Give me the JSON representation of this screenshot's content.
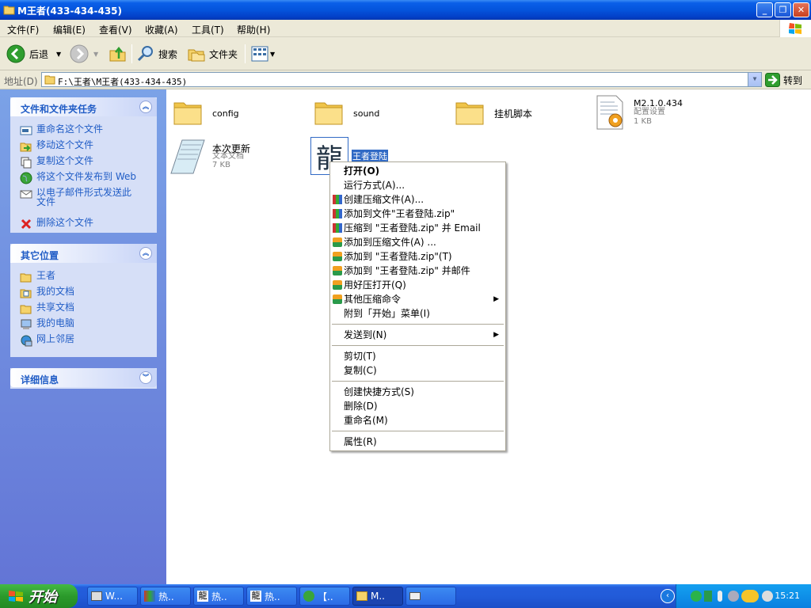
{
  "window": {
    "title": "M王者(433-434-435)",
    "min": "_",
    "max": "❐",
    "close": "✕"
  },
  "menu": [
    "文件(F)",
    "编辑(E)",
    "查看(V)",
    "收藏(A)",
    "工具(T)",
    "帮助(H)"
  ],
  "toolbar": {
    "back": "后退",
    "search": "搜索",
    "folders": "文件夹"
  },
  "address": {
    "label": "地址(D)",
    "value": "F:\\王者\\M王者(433-434-435)",
    "go": "转到"
  },
  "tasks": {
    "file_tasks": {
      "title": "文件和文件夹任务",
      "items": [
        "重命名这个文件",
        "移动这个文件",
        "复制这个文件",
        "将这个文件发布到 Web",
        "以电子邮件形式发送此文件",
        "删除这个文件"
      ]
    },
    "other_places": {
      "title": "其它位置",
      "items": [
        "王者",
        "我的文档",
        "共享文档",
        "我的电脑",
        "网上邻居"
      ]
    },
    "details": {
      "title": "详细信息"
    }
  },
  "files": [
    {
      "name": "config"
    },
    {
      "name": "sound"
    },
    {
      "name": "挂机脚本"
    },
    {
      "name": "M2.1.0.434",
      "type": "配置设置",
      "size": "1 KB"
    },
    {
      "name": "本次更新",
      "type": "文本文档",
      "size": "7 KB"
    },
    {
      "name": "王者登陆"
    }
  ],
  "context_menu": [
    "打开(O)",
    "运行方式(A)...",
    "创建压缩文件(A)...",
    "添加到文件\"王者登陆.zip\"",
    "压缩到 \"王者登陆.zip\" 并 Email",
    "添加到压缩文件(A) ...",
    "添加到 \"王者登陆.zip\"(T)",
    "添加到 \"王者登陆.zip\" 并邮件",
    "用好压打开(Q)",
    "其他压缩命令",
    "附到「开始」菜单(I)",
    "发送到(N)",
    "剪切(T)",
    "复制(C)",
    "创建快捷方式(S)",
    "删除(D)",
    "重命名(M)",
    "属性(R)"
  ],
  "taskbar": {
    "start": "开始",
    "tasks": [
      "W...",
      "热..",
      "热..",
      "热..",
      "【..",
      "M..",
      ""
    ],
    "clock": "15:21"
  },
  "colors": {
    "titlebar": "#0454dc",
    "taskpane": "#6375d6",
    "selection": "#316ac5",
    "start": "#2b9a2b"
  }
}
